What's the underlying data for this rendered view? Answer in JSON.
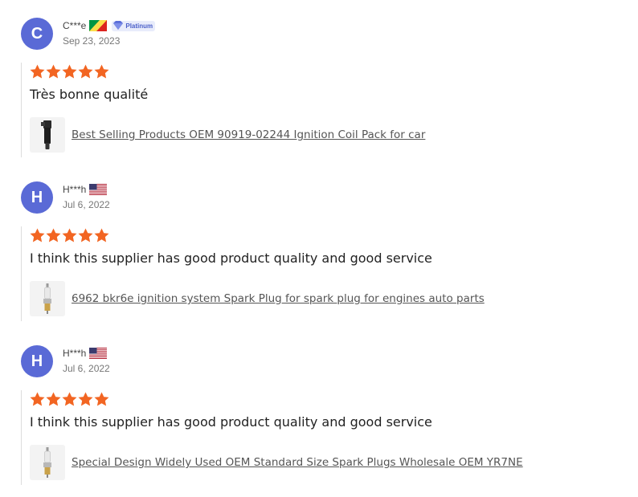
{
  "reviews": [
    {
      "initial": "C",
      "username": "C***e",
      "flag": "congo-flag-icon",
      "badge": "Platinum",
      "date": "Sep 23, 2023",
      "rating": 5,
      "comment": "Très bonne qualité",
      "product": "Best Selling Products OEM 90919-02244 Ignition Coil Pack for car",
      "thumb": "ignition-coil-icon"
    },
    {
      "initial": "H",
      "username": "H***h",
      "flag": "us-flag-icon",
      "date": "Jul 6, 2022",
      "rating": 5,
      "comment": "I think this supplier has good product quality and good service",
      "product": "6962 bkr6e ignition system Spark Plug for spark plug for engines auto parts",
      "thumb": "spark-plug-icon"
    },
    {
      "initial": "H",
      "username": "H***h",
      "flag": "us-flag-icon",
      "date": "Jul 6, 2022",
      "rating": 5,
      "comment": "I think this supplier has good product quality and good service",
      "product": "Special Design Widely Used OEM Standard Size Spark Plugs Wholesale OEM YR7NE",
      "thumb": "spark-plug-icon"
    }
  ],
  "colors": {
    "avatar": "#5a6ad6",
    "star": "#f26522",
    "badge": "#4a5fc9"
  }
}
